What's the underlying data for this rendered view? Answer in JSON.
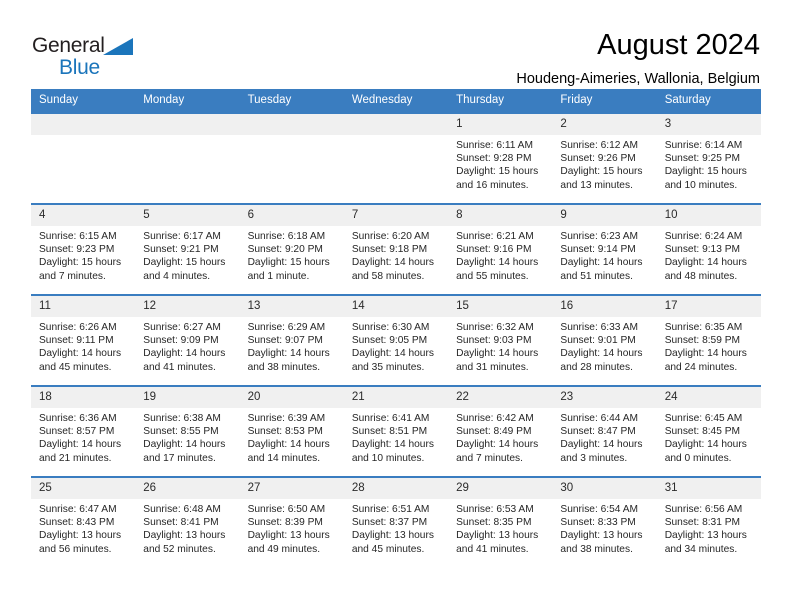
{
  "brand": {
    "name_part1": "General",
    "name_part2": "Blue",
    "triangle_color": "#1b75bb"
  },
  "header": {
    "title": "August 2024",
    "subtitle": "Houdeng-Aimeries, Wallonia, Belgium"
  },
  "theme": {
    "header_blue": "#3a7dc0",
    "daynum_gray": "#f0f0f0",
    "text_dark": "#262626"
  },
  "weekdays": [
    "Sunday",
    "Monday",
    "Tuesday",
    "Wednesday",
    "Thursday",
    "Friday",
    "Saturday"
  ],
  "weeks": [
    [
      {
        "day": "",
        "empty": true
      },
      {
        "day": "",
        "empty": true
      },
      {
        "day": "",
        "empty": true
      },
      {
        "day": "",
        "empty": true
      },
      {
        "day": "1",
        "sunrise": "Sunrise: 6:11 AM",
        "sunset": "Sunset: 9:28 PM",
        "daylight_line1": "Daylight: 15 hours",
        "daylight_line2": "and 16 minutes."
      },
      {
        "day": "2",
        "sunrise": "Sunrise: 6:12 AM",
        "sunset": "Sunset: 9:26 PM",
        "daylight_line1": "Daylight: 15 hours",
        "daylight_line2": "and 13 minutes."
      },
      {
        "day": "3",
        "sunrise": "Sunrise: 6:14 AM",
        "sunset": "Sunset: 9:25 PM",
        "daylight_line1": "Daylight: 15 hours",
        "daylight_line2": "and 10 minutes."
      }
    ],
    [
      {
        "day": "4",
        "sunrise": "Sunrise: 6:15 AM",
        "sunset": "Sunset: 9:23 PM",
        "daylight_line1": "Daylight: 15 hours",
        "daylight_line2": "and 7 minutes."
      },
      {
        "day": "5",
        "sunrise": "Sunrise: 6:17 AM",
        "sunset": "Sunset: 9:21 PM",
        "daylight_line1": "Daylight: 15 hours",
        "daylight_line2": "and 4 minutes."
      },
      {
        "day": "6",
        "sunrise": "Sunrise: 6:18 AM",
        "sunset": "Sunset: 9:20 PM",
        "daylight_line1": "Daylight: 15 hours",
        "daylight_line2": "and 1 minute."
      },
      {
        "day": "7",
        "sunrise": "Sunrise: 6:20 AM",
        "sunset": "Sunset: 9:18 PM",
        "daylight_line1": "Daylight: 14 hours",
        "daylight_line2": "and 58 minutes."
      },
      {
        "day": "8",
        "sunrise": "Sunrise: 6:21 AM",
        "sunset": "Sunset: 9:16 PM",
        "daylight_line1": "Daylight: 14 hours",
        "daylight_line2": "and 55 minutes."
      },
      {
        "day": "9",
        "sunrise": "Sunrise: 6:23 AM",
        "sunset": "Sunset: 9:14 PM",
        "daylight_line1": "Daylight: 14 hours",
        "daylight_line2": "and 51 minutes."
      },
      {
        "day": "10",
        "sunrise": "Sunrise: 6:24 AM",
        "sunset": "Sunset: 9:13 PM",
        "daylight_line1": "Daylight: 14 hours",
        "daylight_line2": "and 48 minutes."
      }
    ],
    [
      {
        "day": "11",
        "sunrise": "Sunrise: 6:26 AM",
        "sunset": "Sunset: 9:11 PM",
        "daylight_line1": "Daylight: 14 hours",
        "daylight_line2": "and 45 minutes."
      },
      {
        "day": "12",
        "sunrise": "Sunrise: 6:27 AM",
        "sunset": "Sunset: 9:09 PM",
        "daylight_line1": "Daylight: 14 hours",
        "daylight_line2": "and 41 minutes."
      },
      {
        "day": "13",
        "sunrise": "Sunrise: 6:29 AM",
        "sunset": "Sunset: 9:07 PM",
        "daylight_line1": "Daylight: 14 hours",
        "daylight_line2": "and 38 minutes."
      },
      {
        "day": "14",
        "sunrise": "Sunrise: 6:30 AM",
        "sunset": "Sunset: 9:05 PM",
        "daylight_line1": "Daylight: 14 hours",
        "daylight_line2": "and 35 minutes."
      },
      {
        "day": "15",
        "sunrise": "Sunrise: 6:32 AM",
        "sunset": "Sunset: 9:03 PM",
        "daylight_line1": "Daylight: 14 hours",
        "daylight_line2": "and 31 minutes."
      },
      {
        "day": "16",
        "sunrise": "Sunrise: 6:33 AM",
        "sunset": "Sunset: 9:01 PM",
        "daylight_line1": "Daylight: 14 hours",
        "daylight_line2": "and 28 minutes."
      },
      {
        "day": "17",
        "sunrise": "Sunrise: 6:35 AM",
        "sunset": "Sunset: 8:59 PM",
        "daylight_line1": "Daylight: 14 hours",
        "daylight_line2": "and 24 minutes."
      }
    ],
    [
      {
        "day": "18",
        "sunrise": "Sunrise: 6:36 AM",
        "sunset": "Sunset: 8:57 PM",
        "daylight_line1": "Daylight: 14 hours",
        "daylight_line2": "and 21 minutes."
      },
      {
        "day": "19",
        "sunrise": "Sunrise: 6:38 AM",
        "sunset": "Sunset: 8:55 PM",
        "daylight_line1": "Daylight: 14 hours",
        "daylight_line2": "and 17 minutes."
      },
      {
        "day": "20",
        "sunrise": "Sunrise: 6:39 AM",
        "sunset": "Sunset: 8:53 PM",
        "daylight_line1": "Daylight: 14 hours",
        "daylight_line2": "and 14 minutes."
      },
      {
        "day": "21",
        "sunrise": "Sunrise: 6:41 AM",
        "sunset": "Sunset: 8:51 PM",
        "daylight_line1": "Daylight: 14 hours",
        "daylight_line2": "and 10 minutes."
      },
      {
        "day": "22",
        "sunrise": "Sunrise: 6:42 AM",
        "sunset": "Sunset: 8:49 PM",
        "daylight_line1": "Daylight: 14 hours",
        "daylight_line2": "and 7 minutes."
      },
      {
        "day": "23",
        "sunrise": "Sunrise: 6:44 AM",
        "sunset": "Sunset: 8:47 PM",
        "daylight_line1": "Daylight: 14 hours",
        "daylight_line2": "and 3 minutes."
      },
      {
        "day": "24",
        "sunrise": "Sunrise: 6:45 AM",
        "sunset": "Sunset: 8:45 PM",
        "daylight_line1": "Daylight: 14 hours",
        "daylight_line2": "and 0 minutes."
      }
    ],
    [
      {
        "day": "25",
        "sunrise": "Sunrise: 6:47 AM",
        "sunset": "Sunset: 8:43 PM",
        "daylight_line1": "Daylight: 13 hours",
        "daylight_line2": "and 56 minutes."
      },
      {
        "day": "26",
        "sunrise": "Sunrise: 6:48 AM",
        "sunset": "Sunset: 8:41 PM",
        "daylight_line1": "Daylight: 13 hours",
        "daylight_line2": "and 52 minutes."
      },
      {
        "day": "27",
        "sunrise": "Sunrise: 6:50 AM",
        "sunset": "Sunset: 8:39 PM",
        "daylight_line1": "Daylight: 13 hours",
        "daylight_line2": "and 49 minutes."
      },
      {
        "day": "28",
        "sunrise": "Sunrise: 6:51 AM",
        "sunset": "Sunset: 8:37 PM",
        "daylight_line1": "Daylight: 13 hours",
        "daylight_line2": "and 45 minutes."
      },
      {
        "day": "29",
        "sunrise": "Sunrise: 6:53 AM",
        "sunset": "Sunset: 8:35 PM",
        "daylight_line1": "Daylight: 13 hours",
        "daylight_line2": "and 41 minutes."
      },
      {
        "day": "30",
        "sunrise": "Sunrise: 6:54 AM",
        "sunset": "Sunset: 8:33 PM",
        "daylight_line1": "Daylight: 13 hours",
        "daylight_line2": "and 38 minutes."
      },
      {
        "day": "31",
        "sunrise": "Sunrise: 6:56 AM",
        "sunset": "Sunset: 8:31 PM",
        "daylight_line1": "Daylight: 13 hours",
        "daylight_line2": "and 34 minutes."
      }
    ]
  ]
}
